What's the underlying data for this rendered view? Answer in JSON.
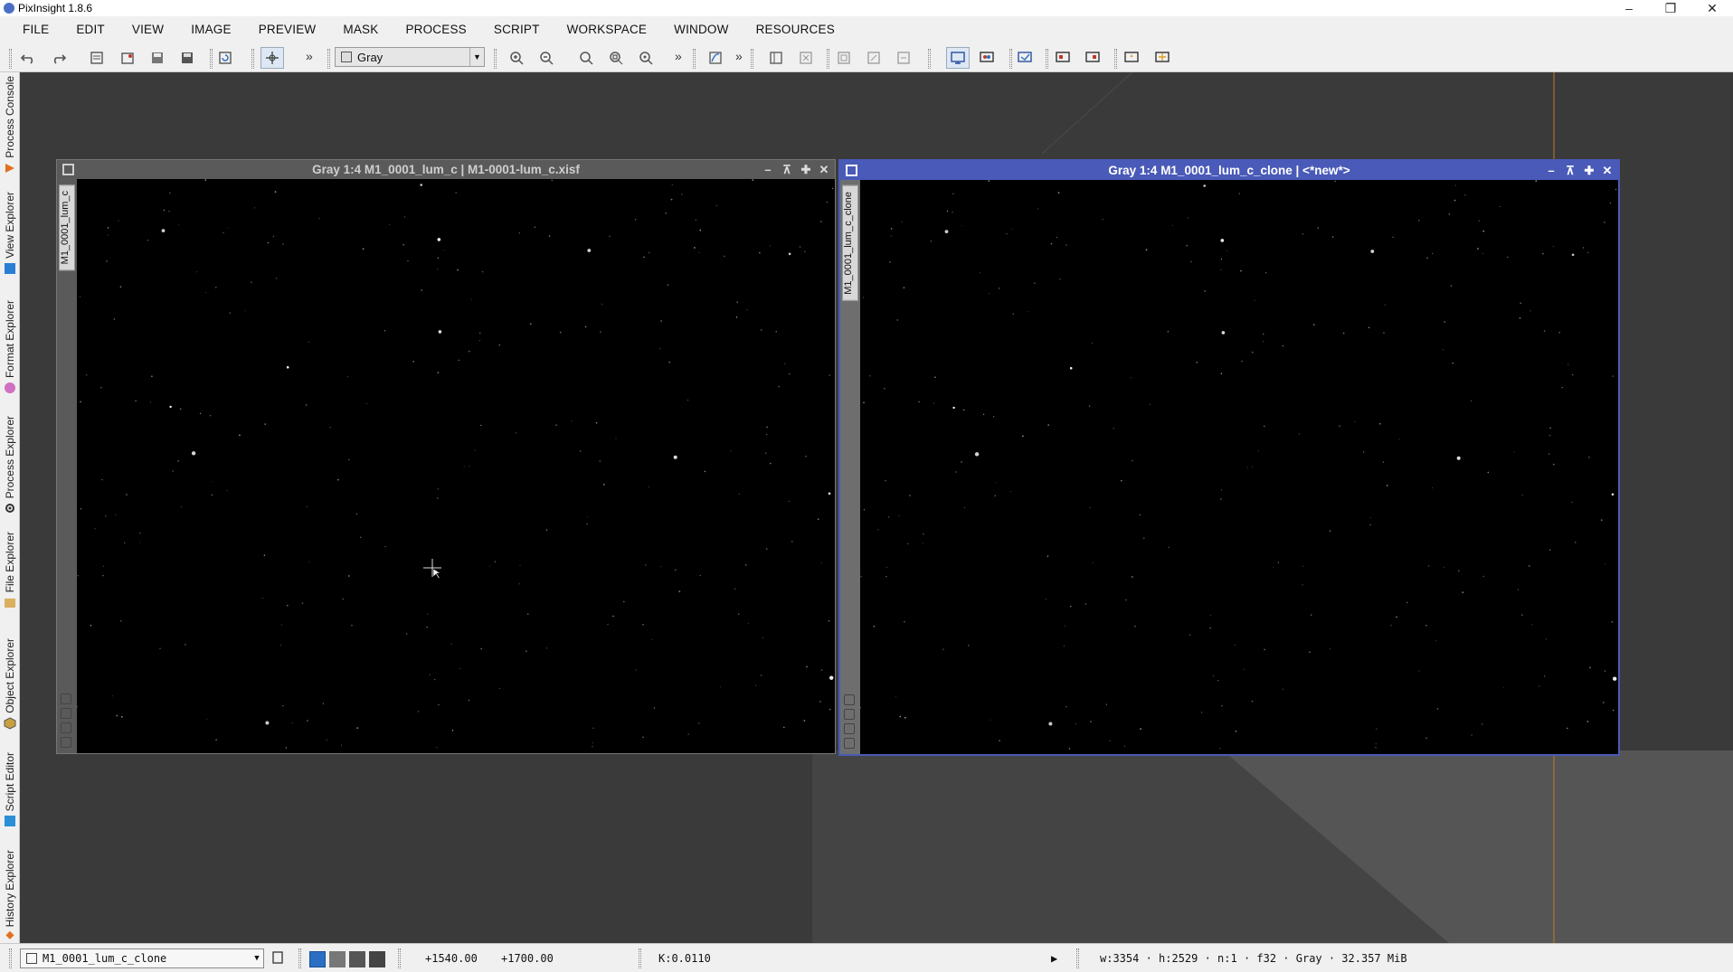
{
  "app": {
    "title": "PixInsight 1.8.6"
  },
  "menu": [
    "FILE",
    "EDIT",
    "VIEW",
    "IMAGE",
    "PREVIEW",
    "MASK",
    "PROCESS",
    "SCRIPT",
    "WORKSPACE",
    "WINDOW",
    "RESOURCES"
  ],
  "toolbar": {
    "colorspace": "Gray"
  },
  "side_tabs": [
    "Process Console",
    "View Explorer",
    "Format Explorer",
    "Process Explorer",
    "File Explorer",
    "Object Explorer",
    "Script Editor",
    "History Explorer"
  ],
  "windows": [
    {
      "title": "Gray 1:4 M1_0001_lum_c | M1-0001-lum_c.xisf",
      "tab": "M1_0001_lum_c",
      "active": false
    },
    {
      "title": "Gray 1:4 M1_0001_lum_c_clone | <*new*>",
      "tab": "M1_0001_lum_c_clone",
      "active": true
    }
  ],
  "status": {
    "view": "M1_0001_lum_c_clone",
    "x": "+1540.00",
    "y": "+1700.00",
    "k": "K:0.0110",
    "info": "w:3354 · h:2529 · n:1 · f32 · Gray · 32.357 MiB"
  },
  "colors": {
    "active_title": "#4a5ab8",
    "inactive_title": "#5a5a5a",
    "desktop": "#3a3a3a",
    "guide_line": "#c07a2e"
  }
}
